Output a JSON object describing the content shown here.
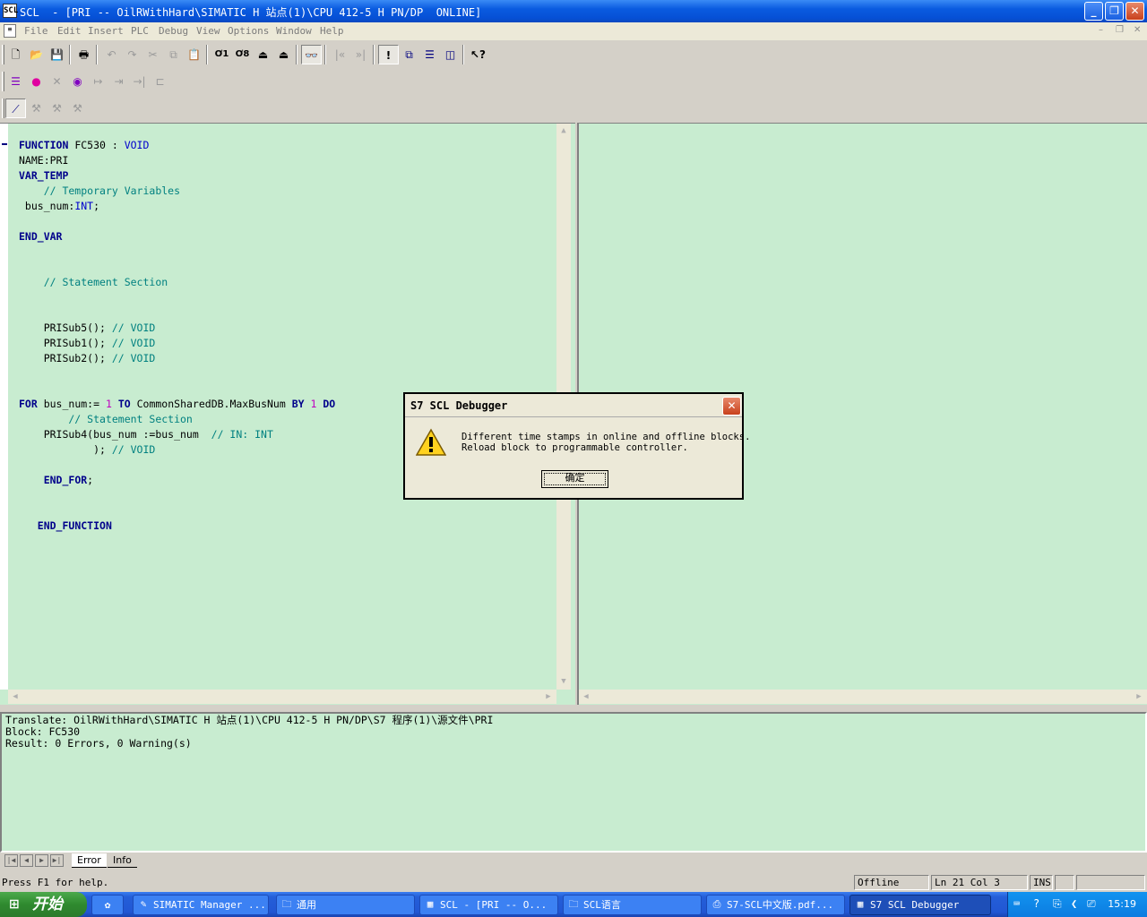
{
  "window": {
    "app_abbrev": "SCL",
    "title": "SCL  - [PRI -- OilRWithHard\\SIMATIC H 站点(1)\\CPU 412-5 H PN/DP  ONLINE]"
  },
  "menu": [
    "File",
    "Edit",
    "Insert",
    "PLC",
    "Debug",
    "View",
    "Options",
    "Window",
    "Help"
  ],
  "code_lines": [
    [
      {
        "t": "FUNCTION",
        "c": "kw"
      },
      {
        "t": " FC530 : "
      },
      {
        "t": "VOID",
        "c": "ty"
      }
    ],
    [
      {
        "t": "NAME:PRI"
      }
    ],
    [
      {
        "t": "VAR_TEMP",
        "c": "kw"
      }
    ],
    [
      {
        "t": "    // Temporary Variables",
        "c": "cm"
      }
    ],
    [
      {
        "t": " bus_num:"
      },
      {
        "t": "INT",
        "c": "ty"
      },
      {
        "t": ";"
      }
    ],
    [
      {
        "t": ""
      }
    ],
    [
      {
        "t": "END_VAR",
        "c": "kw"
      }
    ],
    [
      {
        "t": ""
      }
    ],
    [
      {
        "t": ""
      }
    ],
    [
      {
        "t": "    // Statement Section",
        "c": "cm"
      }
    ],
    [
      {
        "t": ""
      }
    ],
    [
      {
        "t": ""
      }
    ],
    [
      {
        "t": "    PRISub5(); "
      },
      {
        "t": "// VOID",
        "c": "cm"
      }
    ],
    [
      {
        "t": "    PRISub1(); "
      },
      {
        "t": "// VOID",
        "c": "cm"
      }
    ],
    [
      {
        "t": "    PRISub2(); "
      },
      {
        "t": "// VOID",
        "c": "cm"
      }
    ],
    [
      {
        "t": ""
      }
    ],
    [
      {
        "t": ""
      }
    ],
    [
      {
        "t": "FOR",
        "c": "kw"
      },
      {
        "t": " bus_num:= "
      },
      {
        "t": "1",
        "c": "num"
      },
      {
        "t": " "
      },
      {
        "t": "TO",
        "c": "kw"
      },
      {
        "t": " CommonSharedDB.MaxBusNum "
      },
      {
        "t": "BY",
        "c": "kw"
      },
      {
        "t": " "
      },
      {
        "t": "1",
        "c": "num"
      },
      {
        "t": " "
      },
      {
        "t": "DO",
        "c": "kw"
      }
    ],
    [
      {
        "t": "        // Statement Section",
        "c": "cm"
      }
    ],
    [
      {
        "t": "    PRISub4(bus_num :=bus_num  "
      },
      {
        "t": "// IN: INT",
        "c": "cm"
      }
    ],
    [
      {
        "t": "            ); "
      },
      {
        "t": "// VOID",
        "c": "cm"
      }
    ],
    [
      {
        "t": ""
      }
    ],
    [
      {
        "t": "    "
      },
      {
        "t": "END_FOR",
        "c": "kw"
      },
      {
        "t": ";"
      }
    ],
    [
      {
        "t": ""
      }
    ],
    [
      {
        "t": ""
      }
    ],
    [
      {
        "t": "   "
      },
      {
        "t": "END_FUNCTION",
        "c": "kw"
      }
    ]
  ],
  "output": {
    "lines": [
      "Translate: OilRWithHard\\SIMATIC H 站点(1)\\CPU 412-5 H PN/DP\\S7 程序(1)\\源文件\\PRI",
      "Block: FC530",
      "Result: 0 Errors, 0 Warning(s)"
    ],
    "tabs": [
      "Error",
      "Info"
    ]
  },
  "dialog": {
    "title": "S7 SCL Debugger",
    "message_line1": "Different time stamps in online and offline blocks.",
    "message_line2": "Reload block to programmable controller.",
    "ok_label": "确定"
  },
  "status": {
    "help": "Press F1 for help.",
    "mode": "Offline",
    "position": "Ln 21 Col 3",
    "ins": "INS"
  },
  "taskbar": {
    "start_label": "开始",
    "buttons": [
      "SIMATIC Manager ...",
      "通用",
      "SCL  - [PRI -- O...",
      "SCL语言",
      "S7-SCL中文版.pdf...",
      "S7 SCL Debugger"
    ],
    "clock": "15:19"
  },
  "colors": {
    "editor_bg": "#c8ecd0",
    "keyword": "#00008b",
    "comment": "#008080"
  }
}
